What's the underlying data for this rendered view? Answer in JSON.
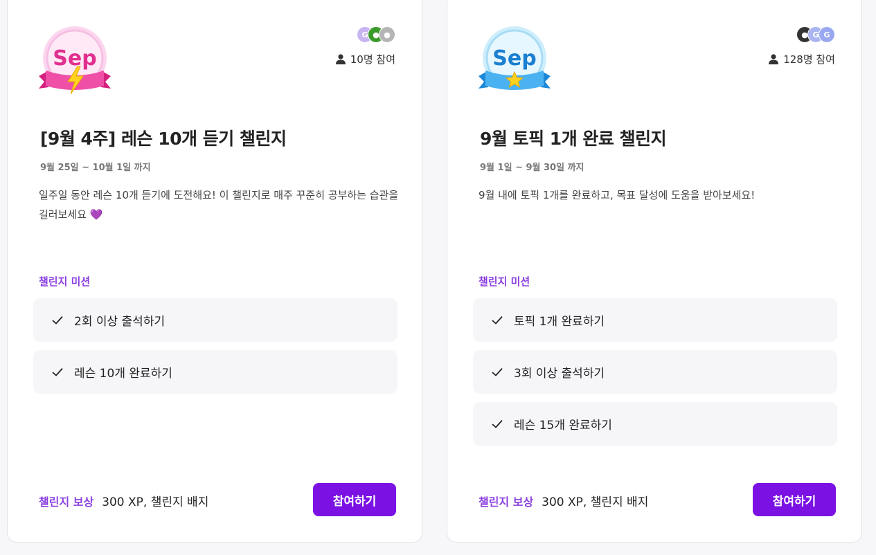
{
  "colors": {
    "accent": "#7b12e3",
    "accent_text": "#8b3fe0",
    "card_bg": "#ffffff",
    "mission_bg": "#f6f6f9"
  },
  "cards": [
    {
      "badge": {
        "text": "Sep",
        "theme": "pink",
        "icon": "lightning-icon"
      },
      "avatars": [
        {
          "color": "#c8b4f0",
          "icon": "avatar-icon"
        },
        {
          "color": "#3a9a2a",
          "icon": "avatar-icon"
        },
        {
          "color": "#b5b5b5",
          "icon": "avatar-icon"
        }
      ],
      "participants": "10명 참여",
      "title": "[9월 4주] 레슨 10개 듣기 챌린지",
      "date": "9월 25일 ~ 10월 1일 까지",
      "description": "일주일 동안 레슨 10개 듣기에 도전해요! 이 챌린지로 매주 꾸준히 공부하는 습관을 길러보세요",
      "description_emoji": "💜",
      "mission_label": "챌린지 미션",
      "missions": [
        "2회 이상 출석하기",
        "레슨 10개 완료하기"
      ],
      "reward_label": "챌린지 보상",
      "reward_value": "300 XP, 챌린지 배지",
      "join_label": "참여하기"
    },
    {
      "badge": {
        "text": "Sep",
        "theme": "blue",
        "icon": "star-icon"
      },
      "avatars": [
        {
          "color": "#333333",
          "icon": "avatar-icon"
        },
        {
          "color": "#a9b4f0",
          "icon": "avatar-icon"
        },
        {
          "color": "#9aa8f2",
          "icon": "avatar-icon"
        }
      ],
      "participants": "128명 참여",
      "title": "9월 토픽 1개 완료 챌린지",
      "date": "9월 1일 ~ 9월 30일 까지",
      "description": "9월 내에 토픽 1개를 완료하고, 목표 달성에 도움을 받아보세요!",
      "description_emoji": "",
      "mission_label": "챌린지 미션",
      "missions": [
        "토픽 1개 완료하기",
        "3회 이상 출석하기",
        "레슨 15개 완료하기"
      ],
      "reward_label": "챌린지 보상",
      "reward_value": "300 XP, 챌린지 배지",
      "join_label": "참여하기"
    }
  ]
}
